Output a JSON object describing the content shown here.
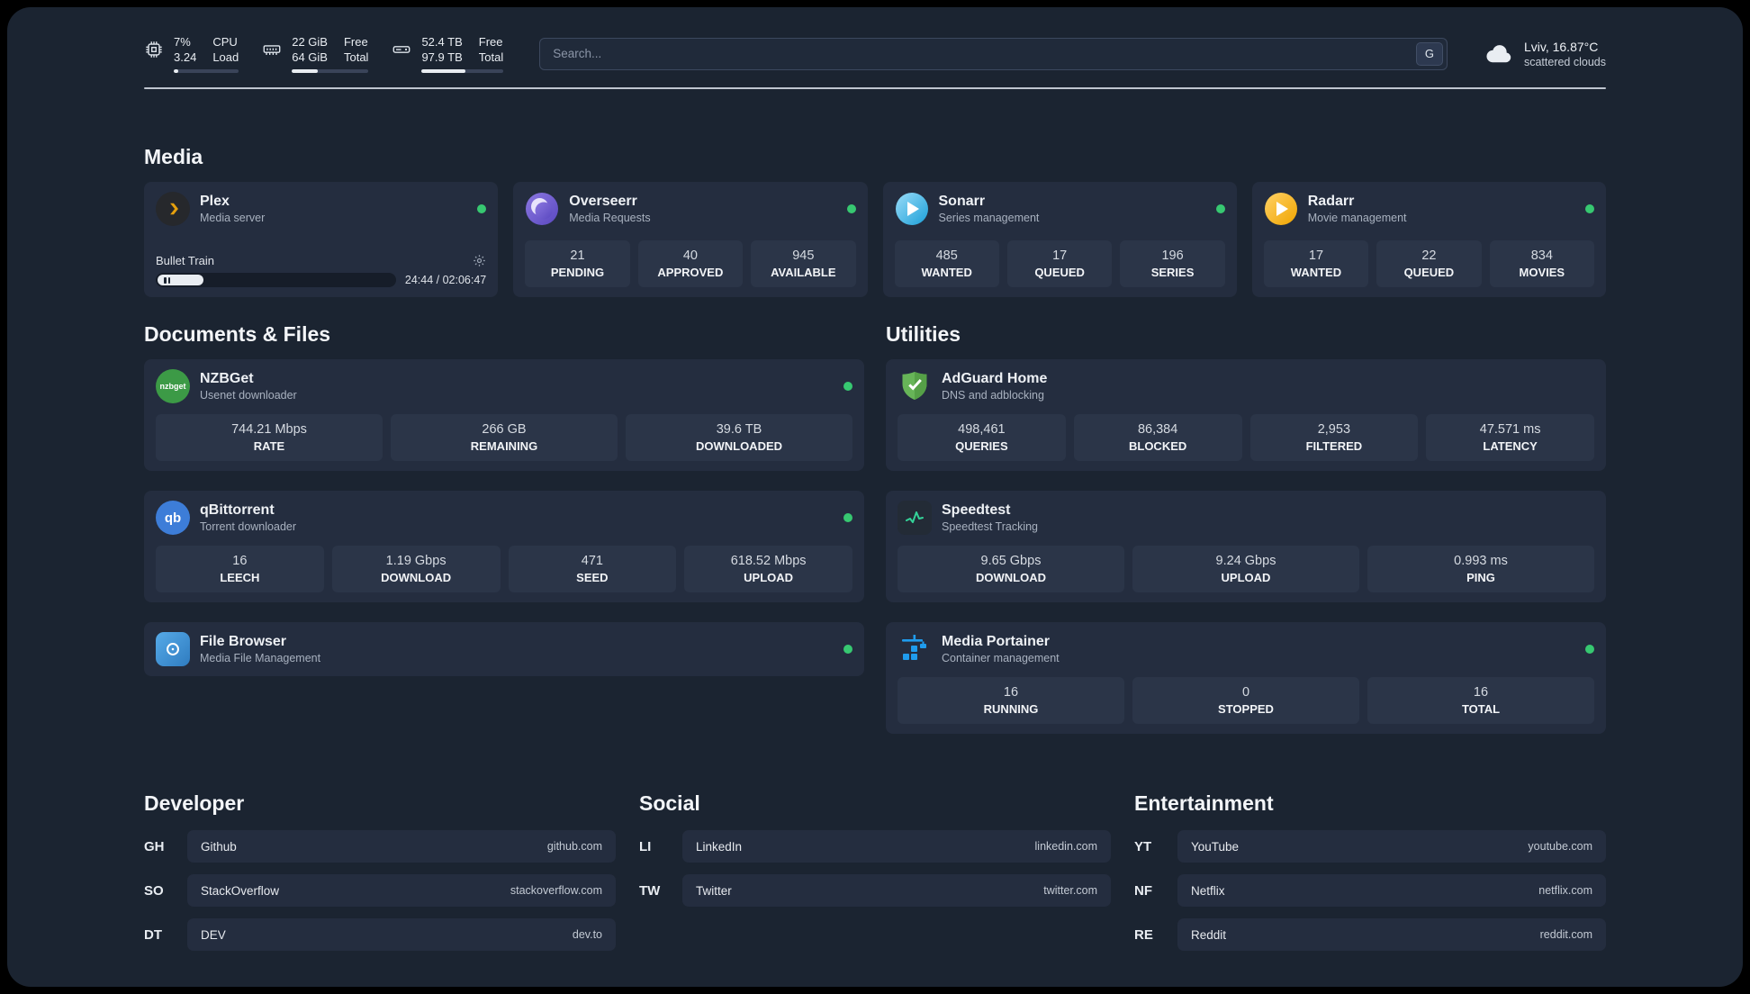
{
  "topbar": {
    "cpu": {
      "value1": "7%",
      "label1": "CPU",
      "value2": "3.24",
      "label2": "Load",
      "progress": 7
    },
    "ram": {
      "value1": "22 GiB",
      "label1": "Free",
      "value2": "64 GiB",
      "label2": "Total",
      "progress": 34
    },
    "disk": {
      "value1": "52.4 TB",
      "label1": "Free",
      "value2": "97.9 TB",
      "label2": "Total",
      "progress": 53
    },
    "search": {
      "placeholder": "Search...",
      "button_label": "G"
    },
    "weather": {
      "location": "Lviv, 16.87°C",
      "condition": "scattered clouds"
    }
  },
  "media": {
    "title": "Media",
    "plex": {
      "title": "Plex",
      "subtitle": "Media server",
      "now_playing": {
        "title": "Bullet Train",
        "time": "24:44 / 02:06:47",
        "progress": 19
      }
    },
    "overseerr": {
      "title": "Overseerr",
      "subtitle": "Media Requests",
      "stats": [
        {
          "value": "21",
          "label": "PENDING"
        },
        {
          "value": "40",
          "label": "APPROVED"
        },
        {
          "value": "945",
          "label": "AVAILABLE"
        }
      ]
    },
    "sonarr": {
      "title": "Sonarr",
      "subtitle": "Series management",
      "stats": [
        {
          "value": "485",
          "label": "WANTED"
        },
        {
          "value": "17",
          "label": "QUEUED"
        },
        {
          "value": "196",
          "label": "SERIES"
        }
      ]
    },
    "radarr": {
      "title": "Radarr",
      "subtitle": "Movie management",
      "stats": [
        {
          "value": "17",
          "label": "WANTED"
        },
        {
          "value": "22",
          "label": "QUEUED"
        },
        {
          "value": "834",
          "label": "MOVIES"
        }
      ]
    }
  },
  "documents": {
    "title": "Documents & Files",
    "nzbget": {
      "title": "NZBGet",
      "subtitle": "Usenet downloader",
      "icon_text": "nzbget",
      "stats": [
        {
          "value": "744.21 Mbps",
          "label": "RATE"
        },
        {
          "value": "266 GB",
          "label": "REMAINING"
        },
        {
          "value": "39.6 TB",
          "label": "DOWNLOADED"
        }
      ]
    },
    "qbittorrent": {
      "title": "qBittorrent",
      "subtitle": "Torrent downloader",
      "icon_text": "qb",
      "stats": [
        {
          "value": "16",
          "label": "LEECH"
        },
        {
          "value": "1.19 Gbps",
          "label": "DOWNLOAD"
        },
        {
          "value": "471",
          "label": "SEED"
        },
        {
          "value": "618.52 Mbps",
          "label": "UPLOAD"
        }
      ]
    },
    "filebrowser": {
      "title": "File Browser",
      "subtitle": "Media File Management"
    }
  },
  "utilities": {
    "title": "Utilities",
    "adguard": {
      "title": "AdGuard Home",
      "subtitle": "DNS and adblocking",
      "stats": [
        {
          "value": "498,461",
          "label": "QUERIES"
        },
        {
          "value": "86,384",
          "label": "BLOCKED"
        },
        {
          "value": "2,953",
          "label": "FILTERED"
        },
        {
          "value": "47.571 ms",
          "label": "LATENCY"
        }
      ]
    },
    "speedtest": {
      "title": "Speedtest",
      "subtitle": "Speedtest Tracking",
      "stats": [
        {
          "value": "9.65 Gbps",
          "label": "DOWNLOAD"
        },
        {
          "value": "9.24 Gbps",
          "label": "UPLOAD"
        },
        {
          "value": "0.993 ms",
          "label": "PING"
        }
      ]
    },
    "portainer": {
      "title": "Media Portainer",
      "subtitle": "Container management",
      "stats": [
        {
          "value": "16",
          "label": "RUNNING"
        },
        {
          "value": "0",
          "label": "STOPPED"
        },
        {
          "value": "16",
          "label": "TOTAL"
        }
      ]
    }
  },
  "bookmarks": [
    {
      "title": "Developer",
      "items": [
        {
          "abbr": "GH",
          "name": "Github",
          "url": "github.com"
        },
        {
          "abbr": "SO",
          "name": "StackOverflow",
          "url": "stackoverflow.com"
        },
        {
          "abbr": "DT",
          "name": "DEV",
          "url": "dev.to"
        }
      ]
    },
    {
      "title": "Social",
      "items": [
        {
          "abbr": "LI",
          "name": "LinkedIn",
          "url": "linkedin.com"
        },
        {
          "abbr": "TW",
          "name": "Twitter",
          "url": "twitter.com"
        }
      ]
    },
    {
      "title": "Entertainment",
      "items": [
        {
          "abbr": "YT",
          "name": "YouTube",
          "url": "youtube.com"
        },
        {
          "abbr": "NF",
          "name": "Netflix",
          "url": "netflix.com"
        },
        {
          "abbr": "RE",
          "name": "Reddit",
          "url": "reddit.com"
        }
      ]
    }
  ]
}
